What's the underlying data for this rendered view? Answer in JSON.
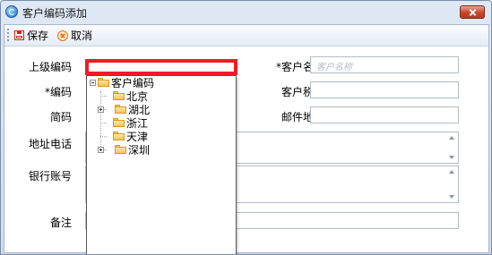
{
  "window": {
    "title": "客户编码添加"
  },
  "toolbar": {
    "save_label": "保存",
    "cancel_label": "取消"
  },
  "form": {
    "parent_code_label": "上级编码",
    "customer_name_label": "*客户名称",
    "customer_name_placeholder": "客户名称",
    "code_label": "*编码",
    "tax_no_label": "客户税号",
    "short_code_label": "简码",
    "email_label": "邮件地址",
    "address_phone_label": "地址电话",
    "bank_account_label": "银行账号",
    "remark_label": "备注"
  },
  "tree": {
    "root": "客户编码",
    "children": [
      {
        "label": "北京",
        "expandable": false
      },
      {
        "label": "湖北",
        "expandable": true
      },
      {
        "label": "浙江",
        "expandable": false
      },
      {
        "label": "天津",
        "expandable": false
      },
      {
        "label": "深圳",
        "expandable": true
      }
    ]
  },
  "colors": {
    "highlight_border": "#ee1c24",
    "close_button": "#c9452b"
  }
}
